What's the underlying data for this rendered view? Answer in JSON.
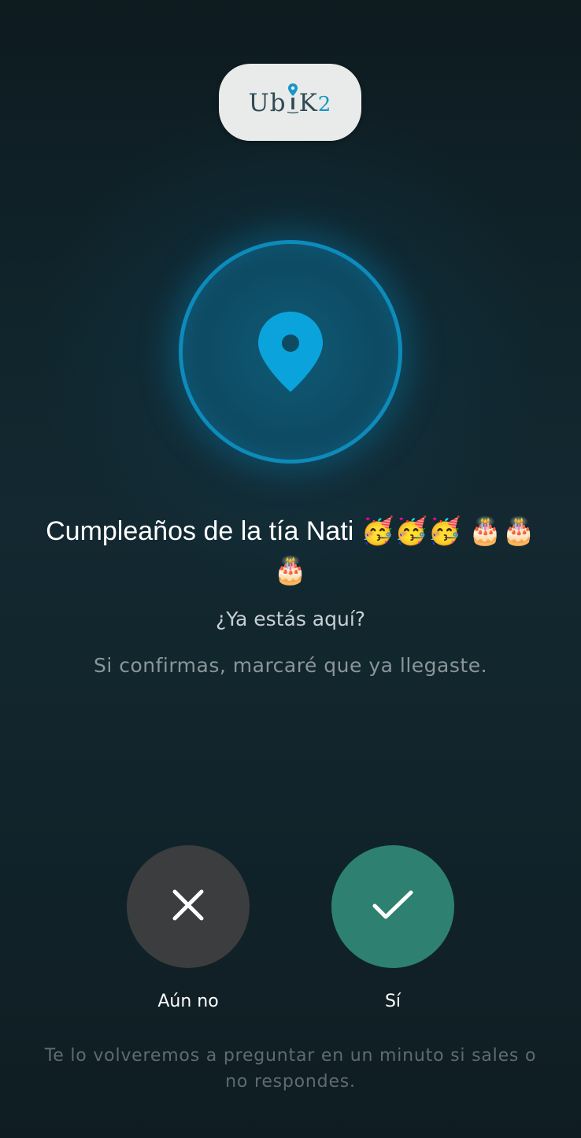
{
  "logo": {
    "text_left": "Ub",
    "text_right": "K",
    "text_number": "2",
    "accent_color": "#1796c8"
  },
  "location_icon": "map-pin-icon",
  "event": {
    "title": "Cumpleaños de la tía Nati 🥳🥳🥳 🎂🎂🎂"
  },
  "prompt": {
    "question": "¿Ya estás aquí?",
    "description": "Si confirmas, marcaré que ya llegaste."
  },
  "actions": {
    "no": {
      "label": "Aún no",
      "icon": "close-icon",
      "color": "#3b3d3e"
    },
    "yes": {
      "label": "Sí",
      "icon": "check-icon",
      "color": "#2e8170"
    }
  },
  "footer": {
    "note": "Te lo volveremos a preguntar en un minuto si sales o no respondes."
  }
}
